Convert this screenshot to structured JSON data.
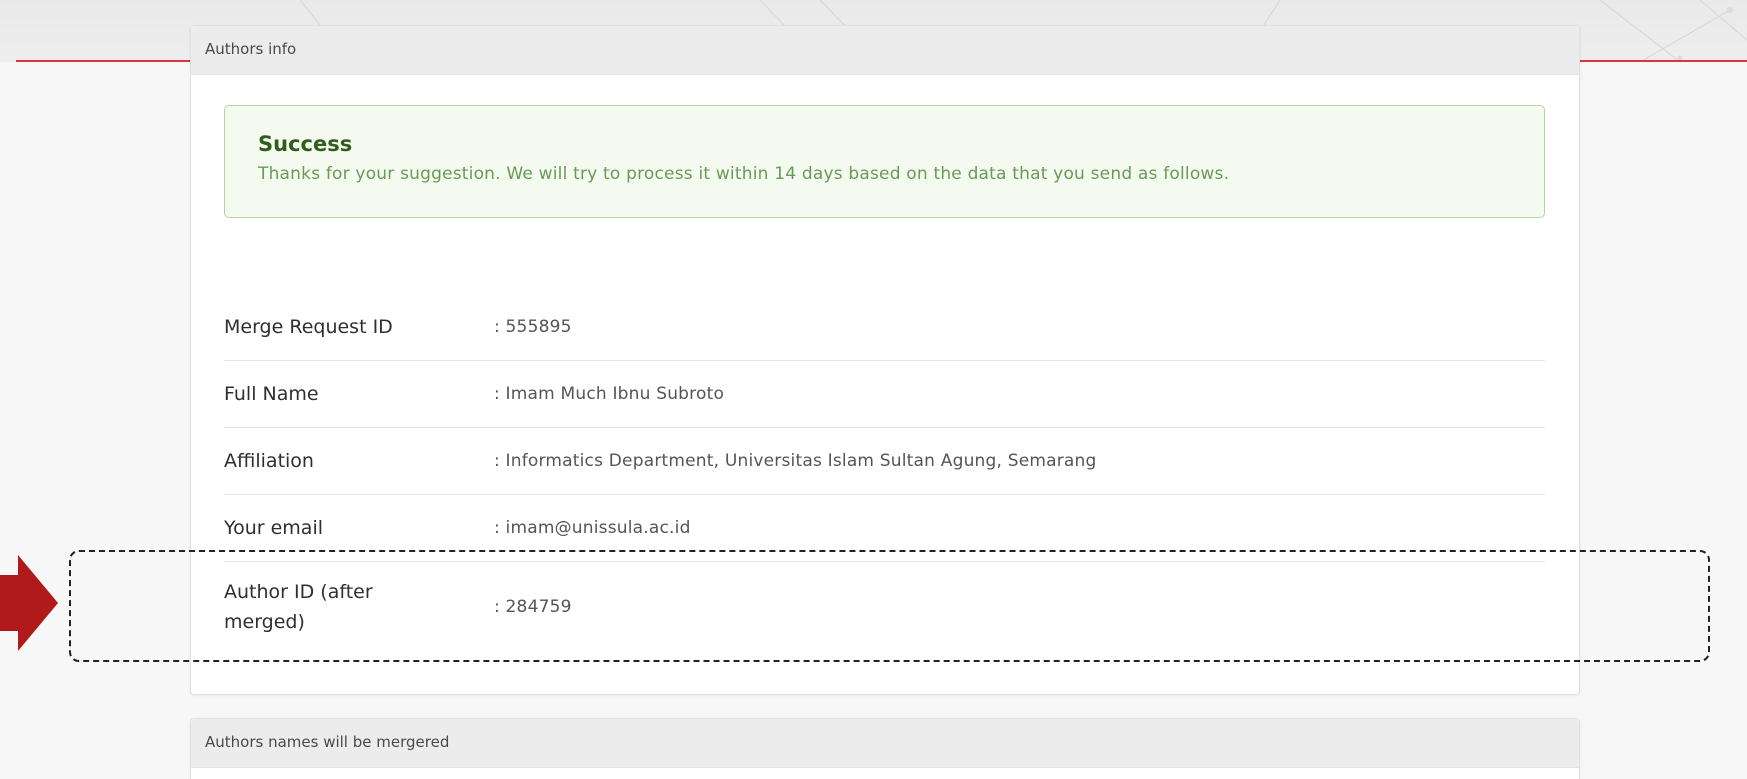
{
  "panels": {
    "authors_info": {
      "heading": "Authors info"
    },
    "authors_names": {
      "heading": "Authors names will be mergered"
    }
  },
  "alert": {
    "title": "Success",
    "message": "Thanks for your suggestion. We will try to process it within 14 days based on the data that you send as follows."
  },
  "info_rows": [
    {
      "label": "Merge Request ID",
      "value": ": 555895"
    },
    {
      "label": "Full Name",
      "value": ": Imam Much Ibnu Subroto"
    },
    {
      "label": "Affiliation",
      "value": ": Informatics Department, Universitas Islam Sultan Agung, Semarang"
    },
    {
      "label": "Your email",
      "value": ": imam@unissula.ac.id"
    },
    {
      "label": "Author ID (after merged)",
      "value": ": 284759"
    }
  ],
  "colors": {
    "accent_red": "#d9353d",
    "annotation_arrow": "#b01a1a",
    "success_border": "#b8d49e",
    "success_title": "#2f5d1c",
    "success_text": "#6a9a58"
  },
  "icons": {
    "annotation": "red-arrow-icon"
  }
}
